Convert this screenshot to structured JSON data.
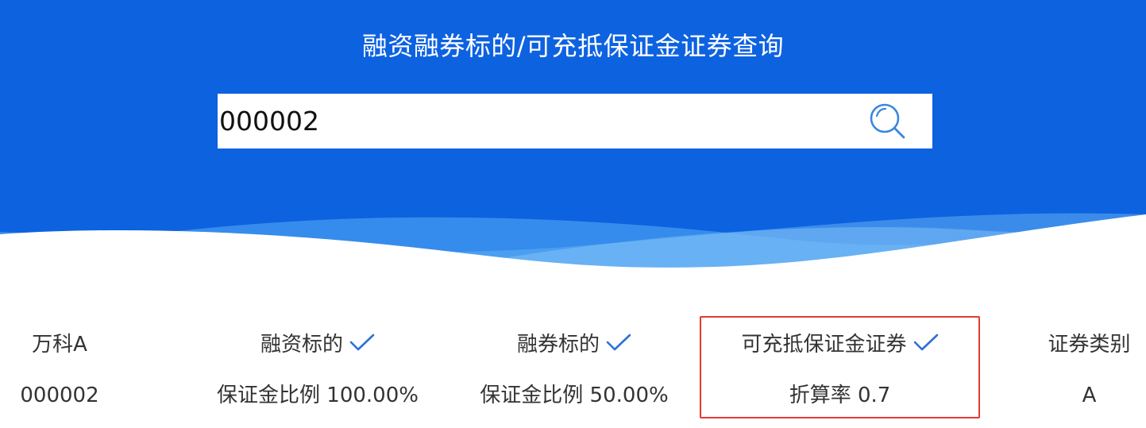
{
  "header": {
    "title": "融资融券标的/可充抵保证金证券查询",
    "background_color": "#0D62E0",
    "wave_colors": [
      "#5AAEF5",
      "#3E8EEA",
      "#8CC8F8"
    ]
  },
  "search": {
    "value": "000002",
    "icon": "search-icon",
    "icon_color": "#3A86E0"
  },
  "result": {
    "stock": {
      "name": "万科A",
      "code": "000002"
    },
    "margin_financing": {
      "label": "融资标的",
      "checked": true,
      "ratio": "保证金比例 100.00%"
    },
    "securities_lending": {
      "label": "融券标的",
      "checked": true,
      "ratio": "保证金比例 50.00%"
    },
    "collateral": {
      "label": "可充抵保证金证券",
      "checked": true,
      "discount": "折算率 0.7",
      "highlight_color": "#E53935"
    },
    "category": {
      "label": "证券类别",
      "value": "A"
    },
    "check_icon": "check-icon",
    "check_color": "#2F6FD6"
  }
}
